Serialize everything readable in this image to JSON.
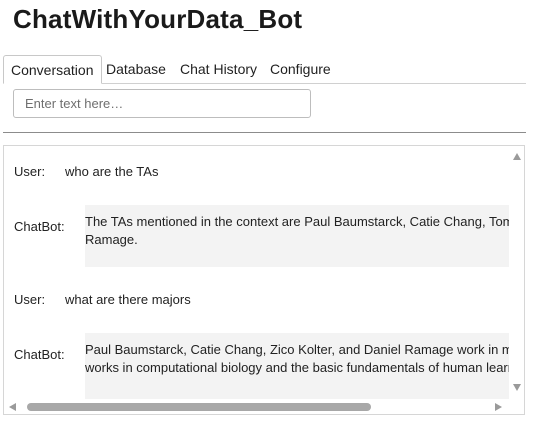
{
  "app": {
    "title": "ChatWithYourData_Bot"
  },
  "tabs": [
    {
      "label": "Conversation",
      "active": true
    },
    {
      "label": "Database",
      "active": false
    },
    {
      "label": "Chat History",
      "active": false
    },
    {
      "label": "Configure",
      "active": false
    }
  ],
  "input": {
    "placeholder": "Enter text here…",
    "value": ""
  },
  "conversation": [
    {
      "speaker": "User:",
      "text": "who are the TAs"
    },
    {
      "speaker": "ChatBot:",
      "lines": [
        "The TAs mentioned in the context are Paul Baumstarck, Catie Chang, Tom",
        "Ramage."
      ]
    },
    {
      "speaker": "User:",
      "text": "what are there majors"
    },
    {
      "speaker": "ChatBot:",
      "lines": [
        "Paul Baumstarck, Catie Chang, Zico Kolter, and Daniel Ramage work in m",
        "works in computational biology and the basic fundamentals of human learn"
      ]
    }
  ],
  "colors": {
    "bot_bubble": "#f3f3f3",
    "scroll_thumb": "#a8a8a8",
    "divider": "#8c8c8c"
  },
  "icons": {
    "scroll_up": "triangle-up-icon",
    "scroll_down": "triangle-down-icon",
    "scroll_left": "triangle-left-icon",
    "scroll_right": "triangle-right-icon"
  }
}
